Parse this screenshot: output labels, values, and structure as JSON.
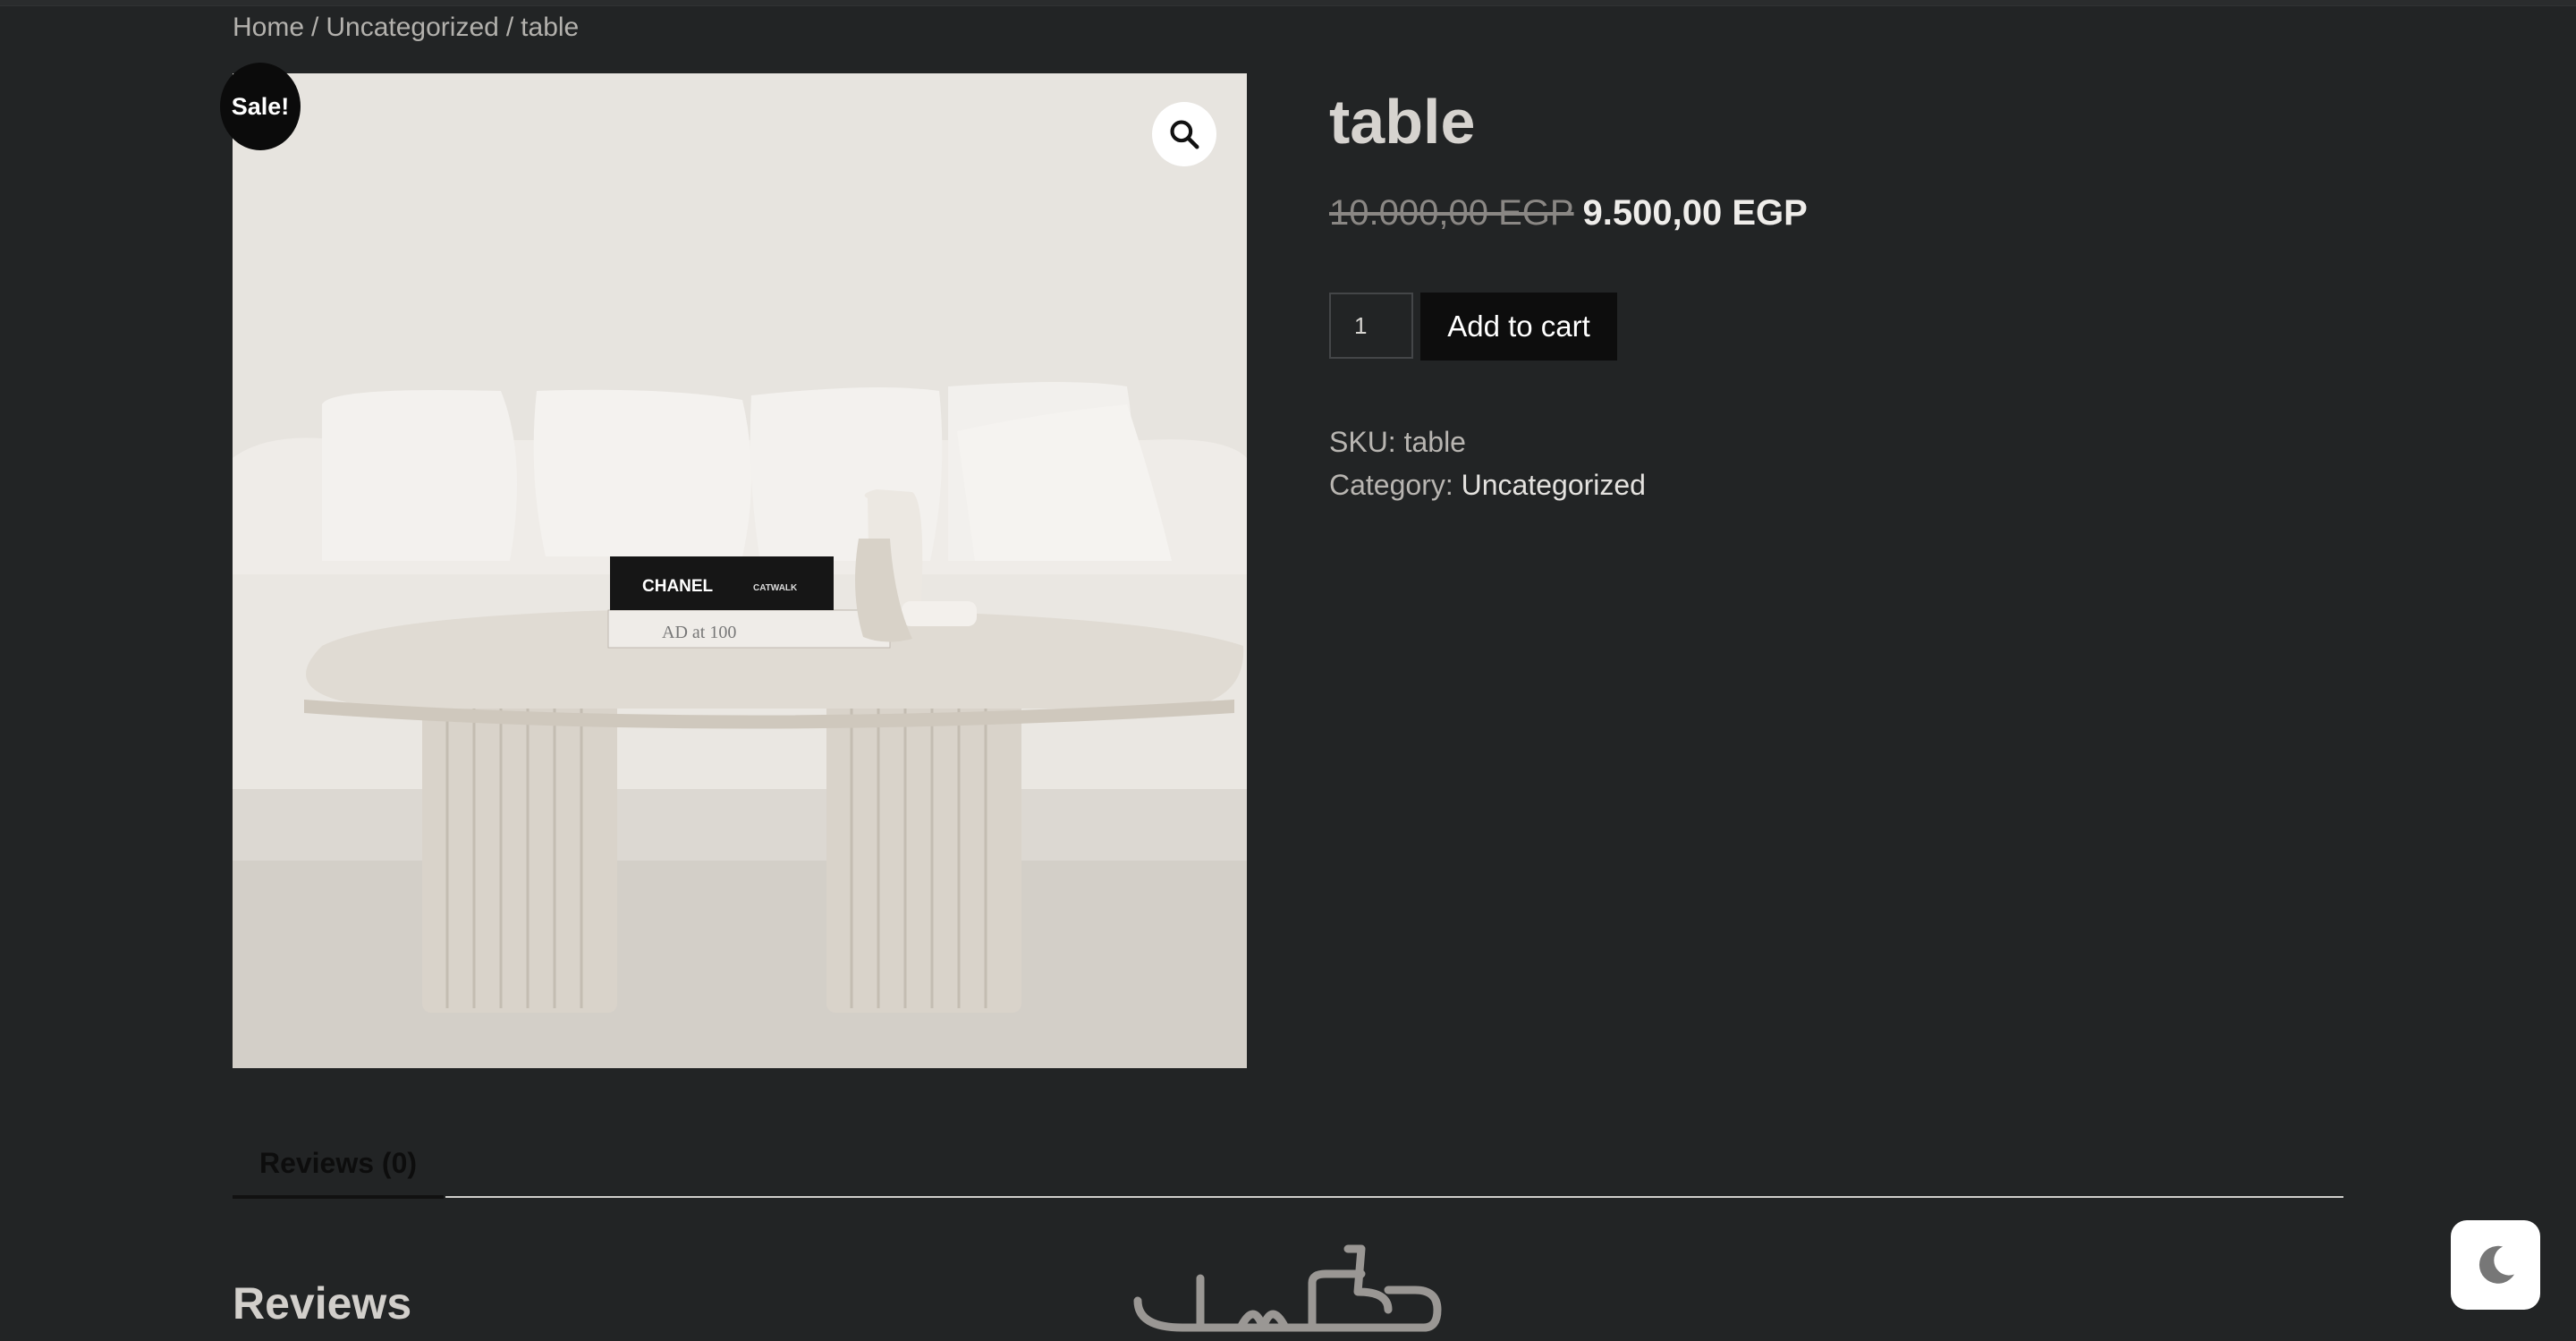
{
  "breadcrumb": {
    "items": [
      "Home",
      "Uncategorized",
      "table"
    ],
    "separator": "/"
  },
  "badge": {
    "sale": "Sale!"
  },
  "gallery": {
    "zoom_icon": "search-icon",
    "image_text": {
      "book_top": "CHANEL",
      "book_top_sub": "CATWALK",
      "book_bottom": "AD at 100"
    }
  },
  "product": {
    "title": "table",
    "old_price": "10.000,00 EGP",
    "new_price": "9.500,00 EGP",
    "quantity": "1",
    "add_to_cart": "Add to cart",
    "sku_label": "SKU:",
    "sku": "table",
    "category_label": "Category:",
    "category": "Uncategorized"
  },
  "tabs": [
    {
      "label": "Reviews (0)"
    }
  ],
  "reviews": {
    "heading": "Reviews"
  },
  "watermark": {
    "text": "خمسات"
  },
  "toggle": {
    "icon": "moon-icon"
  },
  "colors": {
    "background": "#222425",
    "button": "#0d0d0d",
    "badge": "#0b0b0b"
  }
}
